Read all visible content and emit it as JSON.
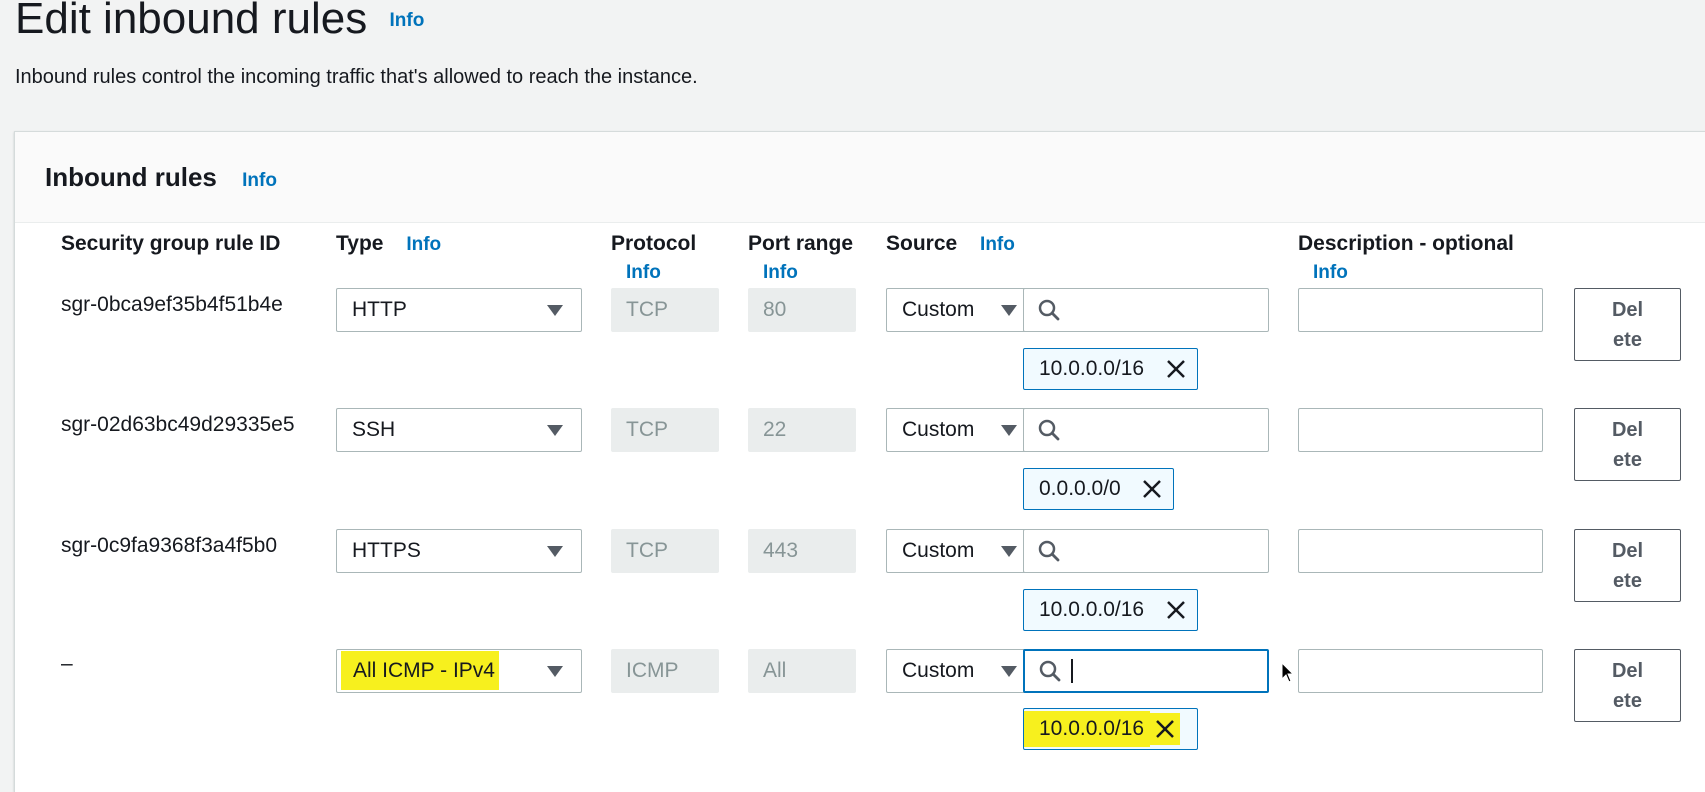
{
  "page": {
    "title": "Edit inbound rules",
    "title_info": "Info",
    "subtitle": "Inbound rules control the incoming traffic that's allowed to reach the instance."
  },
  "panel": {
    "title": "Inbound rules",
    "title_info": "Info"
  },
  "columns": {
    "rule_id": "Security group rule ID",
    "type": "Type",
    "type_info": "Info",
    "protocol": "Protocol",
    "protocol_info": "Info",
    "port_range": "Port range",
    "port_range_info": "Info",
    "source": "Source",
    "source_info": "Info",
    "description": "Description - optional",
    "description_info": "Info"
  },
  "rows": [
    {
      "rule_id": "sgr-0bca9ef35b4f51b4e",
      "type": "HTTP",
      "protocol": "TCP",
      "port_range": "80",
      "source_type": "Custom",
      "source_search": "",
      "cidr": "10.0.0.0/16",
      "description": "",
      "delete_label": "Del ete"
    },
    {
      "rule_id": "sgr-02d63bc49d29335e5",
      "type": "SSH",
      "protocol": "TCP",
      "port_range": "22",
      "source_type": "Custom",
      "source_search": "",
      "cidr": "0.0.0.0/0",
      "description": "",
      "delete_label": "Del ete"
    },
    {
      "rule_id": "sgr-0c9fa9368f3a4f5b0",
      "type": "HTTPS",
      "protocol": "TCP",
      "port_range": "443",
      "source_type": "Custom",
      "source_search": "",
      "cidr": "10.0.0.0/16",
      "description": "",
      "delete_label": "Del ete"
    },
    {
      "rule_id": "–",
      "type": "All ICMP - IPv4",
      "protocol": "ICMP",
      "port_range": "All",
      "source_type": "Custom",
      "source_search": "",
      "cidr": "10.0.0.0/16",
      "description": "",
      "delete_label": "Del ete"
    }
  ],
  "delete_label_line1": "Del",
  "delete_label_line2": "ete",
  "colors": {
    "accent": "#0073bb",
    "highlight": "#f7f01e",
    "token_bg": "#f1faff"
  },
  "icons": [
    "search-icon",
    "close-icon",
    "chevron-down-icon",
    "mouse-pointer-icon"
  ]
}
